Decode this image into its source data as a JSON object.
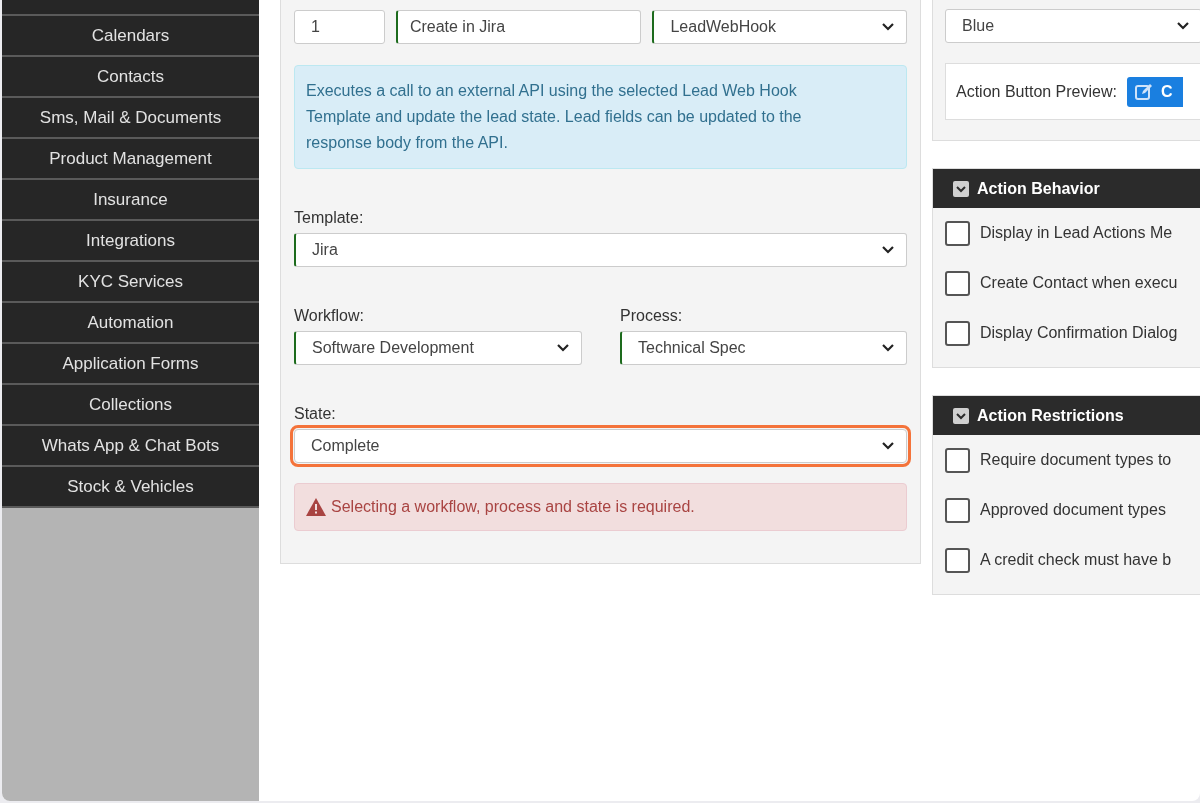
{
  "sidebar": {
    "items": [
      {
        "label": "Calendars"
      },
      {
        "label": "Contacts"
      },
      {
        "label": "Sms, Mail & Documents"
      },
      {
        "label": "Product Management"
      },
      {
        "label": "Insurance"
      },
      {
        "label": "Integrations"
      },
      {
        "label": "KYC Services"
      },
      {
        "label": "Automation"
      },
      {
        "label": "Application Forms"
      },
      {
        "label": "Collections"
      },
      {
        "label": "Whats App & Chat Bots"
      },
      {
        "label": "Stock & Vehicles"
      }
    ]
  },
  "form": {
    "order": {
      "value": "1"
    },
    "action_text": {
      "value": "Create in Jira"
    },
    "action_type": {
      "value": "LeadWebHook"
    },
    "info": "Executes a call to an external API using the selected Lead Web Hook Template and update the lead state. Lead fields can be updated to the response body from the API.",
    "template": {
      "label": "Template:",
      "value": "Jira"
    },
    "workflow": {
      "label": "Workflow:",
      "value": "Software Development"
    },
    "process": {
      "label": "Process:",
      "value": "Technical Spec"
    },
    "state": {
      "label": "State:",
      "value": "Complete",
      "highlighted": true
    },
    "error": "Selecting a workflow, process and state is required."
  },
  "appearance": {
    "color": {
      "value": "Blue"
    },
    "preview_label": "Action Button Preview:",
    "preview_button": "C"
  },
  "panels": [
    {
      "title": "Action Behavior",
      "options": [
        {
          "label": "Display in Lead Actions Me",
          "checked": false
        },
        {
          "label": "Create Contact when execu",
          "checked": false
        },
        {
          "label": "Display Confirmation Dialog",
          "checked": false
        }
      ]
    },
    {
      "title": "Action Restrictions",
      "options": [
        {
          "label": "Require document types to",
          "checked": false
        },
        {
          "label": "Approved document types",
          "checked": false
        },
        {
          "label": "A credit check must have b",
          "checked": false
        }
      ]
    }
  ]
}
